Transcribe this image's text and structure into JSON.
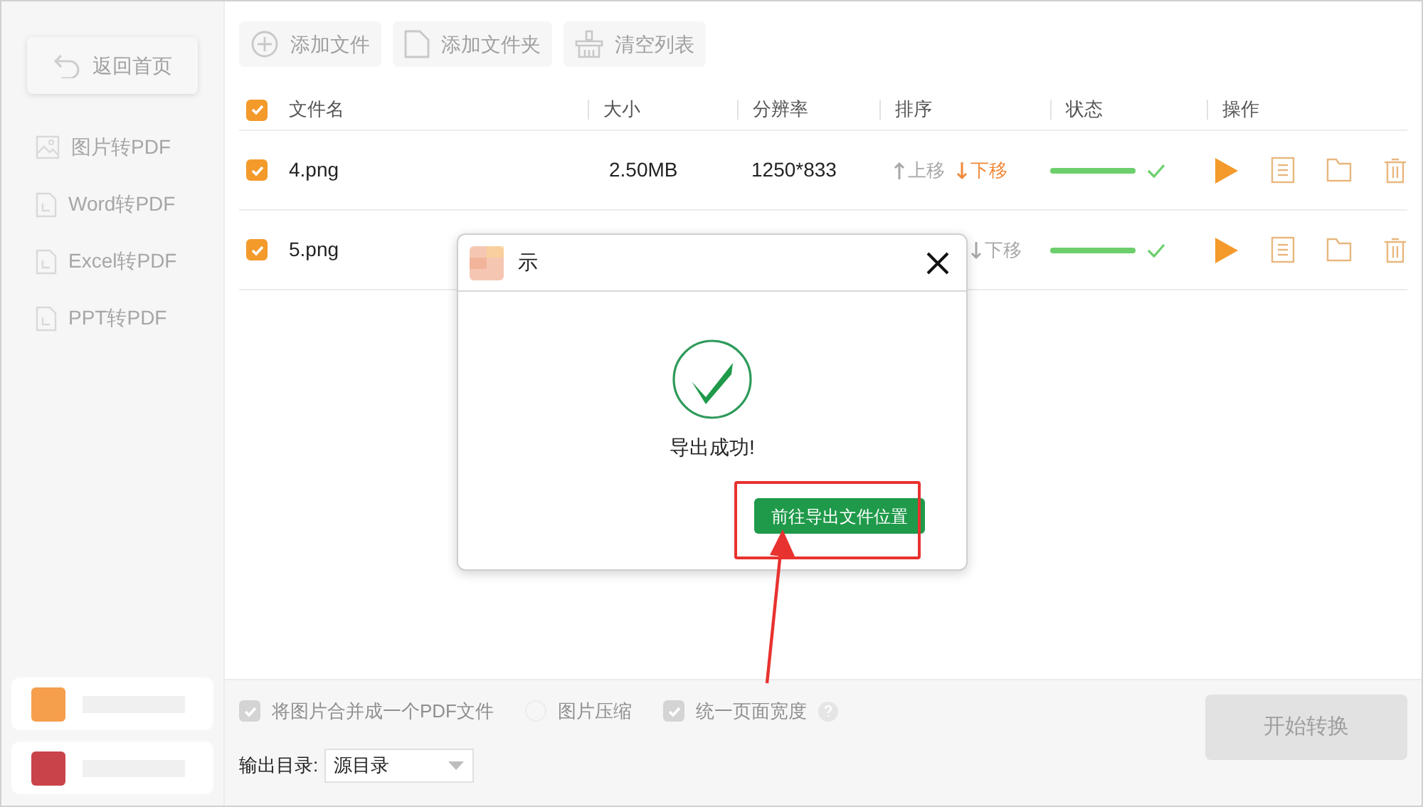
{
  "sidebar": {
    "back_button": "返回首页",
    "items": [
      {
        "label": "图片转PDF",
        "kind": "image"
      },
      {
        "label": "Word转PDF",
        "kind": "doc"
      },
      {
        "label": "Excel转PDF",
        "kind": "doc"
      },
      {
        "label": "PPT转PDF",
        "kind": "doc"
      }
    ],
    "profile_cards": [
      {
        "color": "#f59e4c"
      },
      {
        "color": "#c9434a"
      }
    ]
  },
  "toolbar": [
    {
      "label": "添加文件",
      "kind": "add"
    },
    {
      "label": "添加文件夹",
      "kind": "folder"
    },
    {
      "label": "清空列表",
      "kind": "basket"
    }
  ],
  "table": {
    "select_all": true,
    "columns": [
      "文件名",
      "大小",
      "分辨率",
      "排序",
      "状态",
      "操作"
    ],
    "rows": [
      {
        "checked": true,
        "name": "4.png",
        "size": "2.50MB",
        "resolution": "1250*833",
        "move_up": {
          "label": "上移",
          "disabled": true
        },
        "move_down": {
          "label": "下移",
          "disabled": false
        },
        "level": 1,
        "done": true
      },
      {
        "checked": true,
        "name": "5.png",
        "move_down": {
          "label": "下移",
          "disabled": true
        },
        "level": 1,
        "done": true
      }
    ]
  },
  "options": [
    {
      "label": "将图片合并成一个PDF文件",
      "checked": true,
      "help": false
    },
    {
      "label": "图片压缩",
      "checked": false,
      "help": false
    },
    {
      "label": "统一页面宽度",
      "checked": true,
      "help": true
    }
  ],
  "output": {
    "label": "输出目录:",
    "value": "源目录"
  },
  "start_button": {
    "label": "开始转换",
    "disabled": true
  },
  "dialog": {
    "title": "示",
    "message": "导出成功!",
    "button": "前往导出文件位置"
  }
}
